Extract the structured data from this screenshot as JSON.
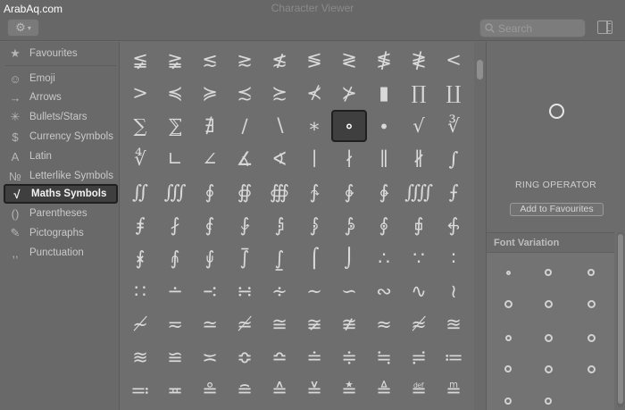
{
  "watermark": "ArabAq.com",
  "window": {
    "title": "Character Viewer",
    "search_placeholder": "Search"
  },
  "sidebar": {
    "items": [
      {
        "label": "Favourites",
        "icon": "★",
        "icon_name": "star-icon"
      },
      {
        "label": "Emoji",
        "icon": "☺",
        "icon_name": "smiley-icon"
      },
      {
        "label": "Arrows",
        "icon": "→",
        "icon_name": "arrow-icon"
      },
      {
        "label": "Bullets/Stars",
        "icon": "✳",
        "icon_name": "asterisk-icon"
      },
      {
        "label": "Currency Symbols",
        "icon": "$",
        "icon_name": "dollar-icon"
      },
      {
        "label": "Latin",
        "icon": "A",
        "icon_name": "latin-a-icon"
      },
      {
        "label": "Letterlike Symbols",
        "icon": "№",
        "icon_name": "numero-icon"
      },
      {
        "label": "Maths Symbols",
        "icon": "√",
        "icon_name": "square-root-icon",
        "selected": true
      },
      {
        "label": "Parentheses",
        "icon": "()",
        "icon_name": "parentheses-icon"
      },
      {
        "label": "Pictographs",
        "icon": "✎",
        "icon_name": "pictograph-icon"
      },
      {
        "label": "Punctuation",
        "icon": ",,",
        "icon_name": "punctuation-icon"
      }
    ]
  },
  "grid": {
    "rows": [
      [
        "≨",
        "≩",
        "≲",
        "≳",
        "≴",
        "≶",
        "≷",
        "≸",
        "≹",
        "<"
      ],
      [
        ">",
        "≼",
        "≽",
        "≾",
        "≿",
        "⊀",
        "⊁",
        "▮",
        "∏",
        "∐"
      ],
      [
        "∑",
        "⅀",
        "∄",
        "∕",
        "∖",
        "∗",
        "∘",
        "∙",
        "√",
        "∛"
      ],
      [
        "∜",
        "∟",
        "∠",
        "∡",
        "∢",
        "∣",
        "∤",
        "∥",
        "∦",
        "∫"
      ],
      [
        "∬",
        "∭",
        "∮",
        "∯",
        "∰",
        "∱",
        "∲",
        "∳",
        "⨌",
        "⨍"
      ],
      [
        "⨎",
        "⨏",
        "⨐",
        "⨑",
        "⨒",
        "⨓",
        "⨔",
        "⨕",
        "⨖",
        "⨗"
      ],
      [
        "⨘",
        "⨙",
        "⨚",
        "⨛",
        "⨜",
        "⌠",
        "⌡",
        "∴",
        "∵",
        "∶"
      ],
      [
        "∷",
        "∸",
        "∹",
        "∺",
        "∻",
        "∼",
        "∽",
        "∾",
        "∿",
        "≀"
      ],
      [
        "≁",
        "≂",
        "≃",
        "≄",
        "≅",
        "≆",
        "≇",
        "≈",
        "≉",
        "≊"
      ],
      [
        "≋",
        "≌",
        "≍",
        "≎",
        "≏",
        "≐",
        "≑",
        "≒",
        "≓",
        "≔"
      ],
      [
        "≕",
        "≖",
        "≗",
        "≘",
        "≙",
        "≚",
        "≛",
        "≜",
        "≝",
        "≞"
      ]
    ],
    "selected_glyph": "∘"
  },
  "detail": {
    "glyph": "∘",
    "name": "RING OPERATOR",
    "add_button": "Add to Favourites",
    "font_variation_title": "Font Variation"
  }
}
